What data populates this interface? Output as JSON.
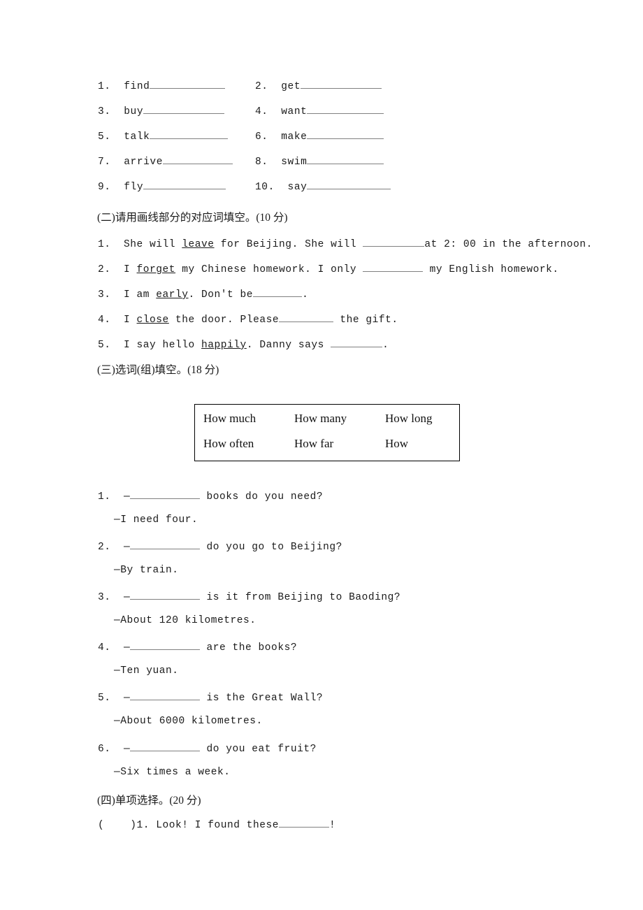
{
  "document": {
    "page_background": "#ffffff",
    "text_color": "#1a1a1a"
  },
  "section_one": {
    "items": [
      {
        "num": "1.",
        "word": "find",
        "blank_width": 108
      },
      {
        "num": "2.",
        "word": "get",
        "blank_width": 116
      },
      {
        "num": "3.",
        "word": "buy",
        "blank_width": 116
      },
      {
        "num": "4.",
        "word": "want",
        "blank_width": 110
      },
      {
        "num": "5.",
        "word": "talk",
        "blank_width": 112
      },
      {
        "num": "6.",
        "word": "make",
        "blank_width": 110
      },
      {
        "num": "7.",
        "word": "arrive",
        "blank_width": 100
      },
      {
        "num": "8.",
        "word": "swim",
        "blank_width": 110
      },
      {
        "num": "9.",
        "word": "fly",
        "blank_width": 118
      },
      {
        "num": "10.",
        "word": "say",
        "blank_width": 120
      }
    ]
  },
  "section_two": {
    "heading": "(二)请用画线部分的对应词填空。(10 分)",
    "items": [
      {
        "num": "1.",
        "before_kw": "  She will ",
        "keyword": "leave",
        "after_kw": " for Beijing. She will ",
        "blank_width": 88,
        "tail": "at 2: 00 in the afternoon."
      },
      {
        "num": "2.",
        "before_kw": "  I ",
        "keyword": "forget",
        "after_kw": " my Chinese homework. I only ",
        "blank_width": 86,
        "tail": " my English homework."
      },
      {
        "num": "3.",
        "before_kw": "  I am ",
        "keyword": "early",
        "after_kw": ". Don't be",
        "blank_width": 70,
        "tail": "."
      },
      {
        "num": "4.",
        "before_kw": "  I ",
        "keyword": "close",
        "after_kw": " the door. Please",
        "blank_width": 78,
        "tail": " the gift."
      },
      {
        "num": "5.",
        "before_kw": "  I say hello ",
        "keyword": "happily",
        "after_kw": ". Danny says ",
        "blank_width": 74,
        "tail": "."
      }
    ]
  },
  "section_three": {
    "heading": "(三)选词(组)填空。(18 分)",
    "word_box": {
      "row1": [
        "How much",
        "How many",
        "How long"
      ],
      "row2": [
        "How often",
        "How far",
        "How"
      ]
    },
    "items": [
      {
        "num": "1.",
        "dash": "—",
        "blank_width": 100,
        "question": " books do you need?",
        "answer": "—I need four."
      },
      {
        "num": "2.",
        "dash": "—",
        "blank_width": 100,
        "question": " do you go to Beijing?",
        "answer": "—By train."
      },
      {
        "num": "3.",
        "dash": "—",
        "blank_width": 100,
        "question": " is it from Beijing to Baoding?",
        "answer": "—About 120 kilometres."
      },
      {
        "num": "4.",
        "dash": "—",
        "blank_width": 100,
        "question": " are the books?",
        "answer": "—Ten yuan."
      },
      {
        "num": "5.",
        "dash": "—",
        "blank_width": 100,
        "question": " is the Great Wall?",
        "answer": "—About 6000 kilometres."
      },
      {
        "num": "6.",
        "dash": "—",
        "blank_width": 100,
        "question": " do you eat fruit?",
        "answer": "—Six times a week."
      }
    ]
  },
  "section_four": {
    "heading": "(四)单项选择。(20 分)",
    "items": [
      {
        "bracket": "(    )1.",
        "text": " Look! I found these",
        "blank_width": 72,
        "tail": "!"
      }
    ]
  }
}
